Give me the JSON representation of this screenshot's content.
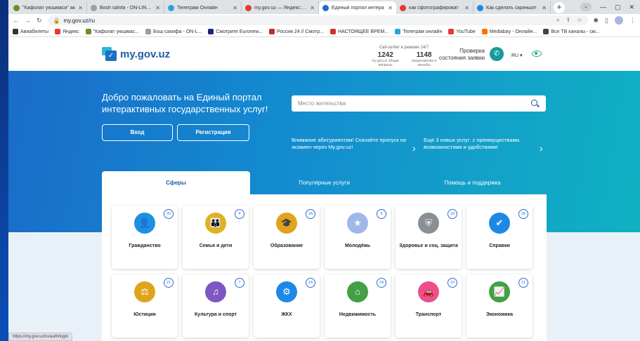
{
  "browser": {
    "tabs": [
      {
        "title": "\"Кафолат уюшмаси\" ак",
        "color": "#6b8e23",
        "active": false
      },
      {
        "title": "Bosh sahifa - ON-LINE o",
        "color": "#9e9e9e",
        "active": false
      },
      {
        "title": "Телеграм Онлайн",
        "color": "#2aa3e0",
        "active": false
      },
      {
        "title": "my.gov.uz — Яндекс: на",
        "color": "#e53935",
        "active": false
      },
      {
        "title": "Единый портал интера",
        "color": "#1d6fc7",
        "active": true
      },
      {
        "title": "как сфотографироват",
        "color": "#e53935",
        "active": false
      },
      {
        "title": "Как сделать скриншот",
        "color": "#1e88e5",
        "active": false
      }
    ],
    "new_tab": "+",
    "url": "my.gov.uz/ru",
    "bookmarks": [
      {
        "label": "Авиабилеты",
        "color": "#333333"
      },
      {
        "label": "Яндекс",
        "color": "#e53935"
      },
      {
        "label": "\"Кафолат уюшмас...",
        "color": "#6b8e23"
      },
      {
        "label": "Бош сахифа - ON-L...",
        "color": "#9e9e9e"
      },
      {
        "label": "Смотрите Euronew...",
        "color": "#1a237e"
      },
      {
        "label": "Россия 24 // Смотр...",
        "color": "#c62828"
      },
      {
        "label": "НАСТОЯЩЕЕ ВРЕМ...",
        "color": "#d32f2f"
      },
      {
        "label": "Телеграм онлайн",
        "color": "#2aa3e0"
      },
      {
        "label": "YouTube",
        "color": "#e53935"
      },
      {
        "label": "Mediabay - Онлайн...",
        "color": "#ff6f00"
      },
      {
        "label": "Все ТВ каналы - см...",
        "color": "#444444"
      }
    ],
    "status_url": "https://my.gov.uz/ru/auth/login"
  },
  "header": {
    "logo_text": "my.gov.uz",
    "callcenter_title": "Call-center в режиме 24/7",
    "stats": [
      {
        "value": "1242",
        "label": "my.gov.uz общие вопросы"
      },
      {
        "value": "1148",
        "label": "предложения и жалобы"
      }
    ],
    "check_status": "Проверка состояния заявки",
    "language": "RU ▾"
  },
  "hero": {
    "welcome": "Добро пожаловать на Единый портал интерактивных государственных услуг!",
    "login_label": "Вход",
    "register_label": "Регистрация",
    "search_placeholder": "Место жительства",
    "notice1": "Внимание абитуриентам! Скачайте пропуск на экзамен через My.gov.uz!",
    "notice2": "Еще 3 новых услуг: с преимуществами, возможностями и удобствами!"
  },
  "section_tabs": [
    "Сферы",
    "Популярные услуги",
    "Помощь и поддержка"
  ],
  "categories": [
    {
      "label": "Гражданство",
      "count": "20",
      "color": "#1e90e0",
      "glyph": "👤"
    },
    {
      "label": "Семья и дети",
      "count": "4",
      "color": "#e0b11e",
      "glyph": "👪"
    },
    {
      "label": "Образование",
      "count": "24",
      "color": "#e0a31e",
      "glyph": "🎓"
    },
    {
      "label": "Молодёжь",
      "count": "6",
      "color": "#9fb8e8",
      "glyph": "★"
    },
    {
      "label": "Здоровье и соц. защита",
      "count": "18",
      "color": "#8a8f96",
      "glyph": "⛨"
    },
    {
      "label": "Справки",
      "count": "35",
      "color": "#1e88e5",
      "glyph": "✔"
    },
    {
      "label": "Юстиция",
      "count": "21",
      "color": "#e0a31e",
      "glyph": "⚖"
    },
    {
      "label": "Культура и спорт",
      "count": "7",
      "color": "#7e57c2",
      "glyph": "♫"
    },
    {
      "label": "ЖКХ",
      "count": "24",
      "color": "#1e88e5",
      "glyph": "⚙"
    },
    {
      "label": "Недвижимость",
      "count": "24",
      "color": "#43a047",
      "glyph": "⌂"
    },
    {
      "label": "Транспорт",
      "count": "19",
      "color": "#ec4f8c",
      "glyph": "🚗"
    },
    {
      "label": "Экономика",
      "count": "11",
      "color": "#43a047",
      "glyph": "📈"
    }
  ]
}
